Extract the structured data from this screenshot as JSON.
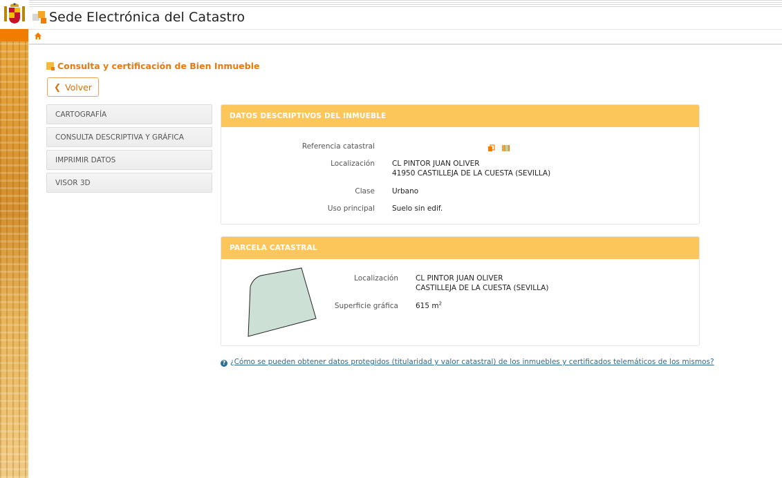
{
  "header": {
    "brand_title": "Sede Electrónica del Catastro"
  },
  "page": {
    "title": "Consulta y certificación de Bien Inmueble",
    "back_label": "Volver"
  },
  "menu": {
    "items": [
      {
        "label": "CARTOGRAFÍA"
      },
      {
        "label": "CONSULTA DESCRIPTIVA Y GRÁFICA"
      },
      {
        "label": "IMPRIMIR DATOS"
      },
      {
        "label": "VISOR 3D"
      }
    ]
  },
  "datos": {
    "header": "DATOS DESCRIPTIVOS DEL INMUEBLE",
    "ref_label": "Referencia catastral",
    "loc_label": "Localización",
    "loc_line1": "CL PINTOR JUAN OLIVER",
    "loc_line2": "41950 CASTILLEJA DE LA CUESTA (SEVILLA)",
    "clase_label": "Clase",
    "clase_value": "Urbano",
    "uso_label": "Uso principal",
    "uso_value": "Suelo sin edif."
  },
  "parcela": {
    "header": "PARCELA CATASTRAL",
    "loc_label": "Localización",
    "loc_line1": "CL PINTOR JUAN OLIVER",
    "loc_line2": "CASTILLEJA DE LA CUESTA (SEVILLA)",
    "sup_label": "Superficie gráfica",
    "sup_value": "615 m",
    "sup_unit_exp": "2"
  },
  "help": {
    "icon": "question-circle-icon",
    "link_text": "¿Cómo se pueden obtener datos protegidos (titularidad y valor catastral) de los inmuebles y certificados telemáticos de los mismos?"
  },
  "colors": {
    "accent_orange": "#f07d00",
    "panel_header": "#fdc65a",
    "title_orange": "#e57b12",
    "link_blue": "#2c6a8c",
    "parcel_fill": "#cde0d6"
  }
}
